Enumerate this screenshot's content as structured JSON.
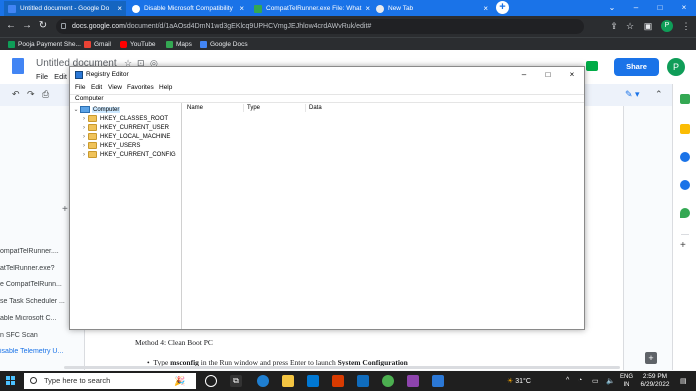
{
  "browser": {
    "tabs": [
      {
        "title": "Untitled document - Google Do",
        "icon_color": "#4285f4",
        "active": true
      },
      {
        "title": "Disable Microsoft Compatibility",
        "icon_color": "#ffffff",
        "active": false
      },
      {
        "title": "CompatTelRunner.exe File: What",
        "icon_color": "#34a853",
        "active": false
      },
      {
        "title": "New Tab",
        "icon_color": "#e8eaed",
        "active": false
      }
    ],
    "address": {
      "host": "docs.google.com",
      "path": "/document/d/1aAOsd4DmN1wd3gEKlcq9UPHCVmgJEJhlow4crdAWvRuk/edit#"
    },
    "profile_initial": "P",
    "bookmarks": [
      {
        "label": "Pooja Payment She...",
        "color": "#0f9d58"
      },
      {
        "label": "Gmail",
        "color": "#ea4335"
      },
      {
        "label": "YouTube",
        "color": "#ff0000"
      },
      {
        "label": "Maps",
        "color": "#34a853"
      },
      {
        "label": "Google Docs",
        "color": "#4285f4"
      }
    ]
  },
  "docs": {
    "title": "Untitled document",
    "menu": [
      "File",
      "Edit"
    ],
    "share_label": "Share",
    "avatar_initial": "P",
    "outline": [
      {
        "label": "ompatTelRunner....",
        "active": false
      },
      {
        "label": "atTelRunner.exe?",
        "active": false
      },
      {
        "label": "e CompatTelRunn...",
        "active": false
      },
      {
        "label": "se Task Scheduler ...",
        "active": false
      },
      {
        "label": "able Microsoft C...",
        "active": false
      },
      {
        "label": "n SFC Scan",
        "active": false
      },
      {
        "label": "isable Telemetry U...",
        "active": true
      }
    ],
    "body": {
      "method_heading": "Method 4: Clean Boot PC",
      "bullet_start": "Type ",
      "bullet_bold": "msconfig",
      "bullet_mid": " in the Run window and press Enter to launch ",
      "bullet_bold2": "System Configuration"
    }
  },
  "regedit": {
    "title": "Registry Editor",
    "menu": [
      "File",
      "Edit",
      "View",
      "Favorites",
      "Help"
    ],
    "address": "Computer",
    "root": "Computer",
    "keys": [
      "HKEY_CLASSES_ROOT",
      "HKEY_CURRENT_USER",
      "HKEY_LOCAL_MACHINE",
      "HKEY_USERS",
      "HKEY_CURRENT_CONFIG"
    ],
    "columns": [
      "Name",
      "Type",
      "Data"
    ]
  },
  "taskbar": {
    "search_placeholder": "Type here to search",
    "weather": "31°C",
    "lang": [
      "ENG",
      "IN"
    ],
    "time": "2:59 PM",
    "date": "6/29/2022"
  }
}
